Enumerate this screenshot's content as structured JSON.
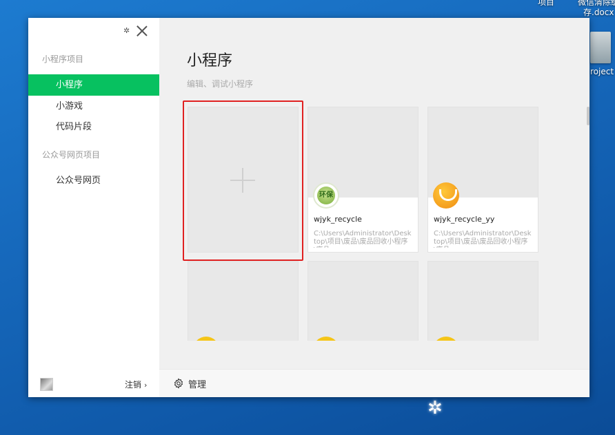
{
  "desktop": {
    "top_label_1": "项目",
    "top_label_2a": "微信清除缓",
    "top_label_2b": "存.docx",
    "project_label": "roject"
  },
  "sidebar": {
    "section_miniprogram": "小程序项目",
    "items": [
      {
        "label": "小程序",
        "active": true
      },
      {
        "label": "小游戏",
        "active": false
      },
      {
        "label": "代码片段",
        "active": false
      }
    ],
    "section_official": "公众号网页项目",
    "official_item": "公众号网页",
    "logout_label": "注销",
    "logout_chevron": "›"
  },
  "main": {
    "title": "小程序",
    "subtitle": "编辑、调试小程序",
    "projects": [
      {
        "name": "wjyk_recycle",
        "path": "C:\\Users\\Administrator\\Desktop\\项目\\废品\\废品回收小程序\\废品",
        "logo": "green-recycle-logo",
        "logo_text": "环保"
      },
      {
        "name": "wjyk_recycle_yy",
        "path": "C:\\Users\\Administrator\\Desktop\\项目\\废品\\废品回收小程序\\废品",
        "logo": "orange-leaf-logo"
      }
    ]
  },
  "bottombar": {
    "manage_label": "管理"
  },
  "colors": {
    "accent": "#07c160",
    "selection": "#e02020"
  }
}
